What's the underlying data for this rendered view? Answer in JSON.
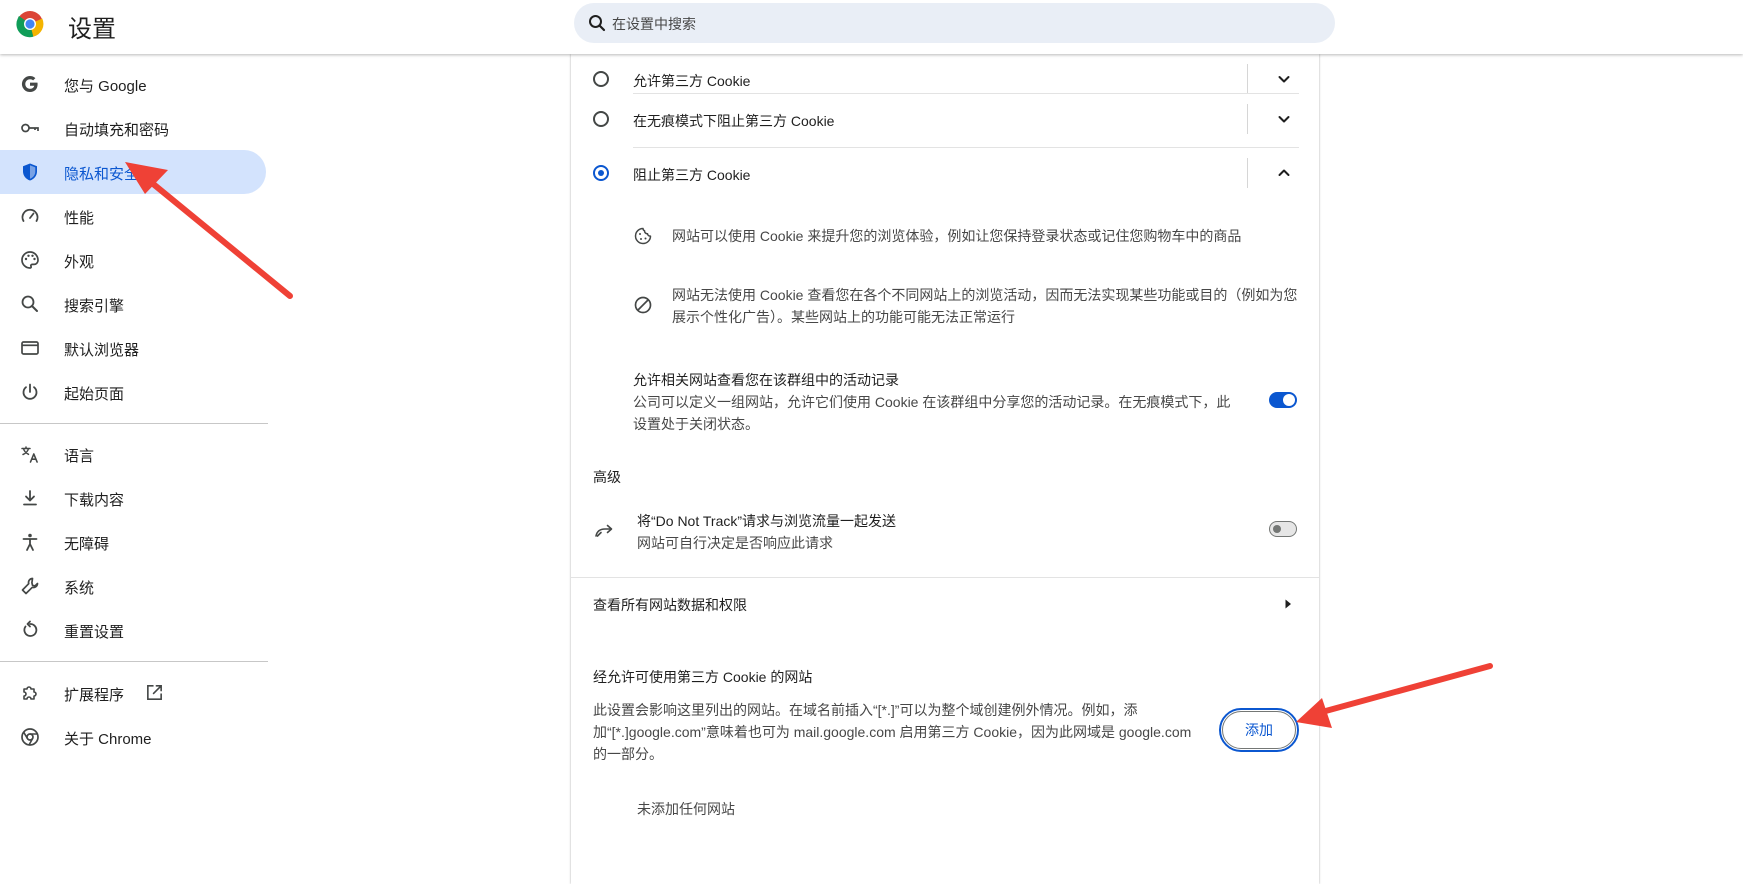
{
  "header": {
    "title": "设置",
    "search_placeholder": "在设置中搜索"
  },
  "sidebar": {
    "items": [
      {
        "label": "您与 Google"
      },
      {
        "label": "自动填充和密码"
      },
      {
        "label": "隐私和安全"
      },
      {
        "label": "性能"
      },
      {
        "label": "外观"
      },
      {
        "label": "搜索引擎"
      },
      {
        "label": "默认浏览器"
      },
      {
        "label": "起始页面"
      },
      {
        "label": "语言"
      },
      {
        "label": "下载内容"
      },
      {
        "label": "无障碍"
      },
      {
        "label": "系统"
      },
      {
        "label": "重置设置"
      },
      {
        "label": "扩展程序"
      },
      {
        "label": "关于 Chrome"
      }
    ],
    "active_index": 2
  },
  "cookies": {
    "options": [
      {
        "label": "允许第三方 Cookie",
        "selected": false,
        "expanded": false
      },
      {
        "label": "在无痕模式下阻止第三方 Cookie",
        "selected": false,
        "expanded": false
      },
      {
        "label": "阻止第三方 Cookie",
        "selected": true,
        "expanded": true
      }
    ],
    "details": [
      {
        "icon": "cookie-icon",
        "text": "网站可以使用 Cookie 来提升您的浏览体验，例如让您保持登录状态或记住您购物车中的商品"
      },
      {
        "icon": "block-icon",
        "text": "网站无法使用 Cookie 查看您在各个不同网站上的浏览活动，因而无法实现某些功能或目的（例如为您展示个性化广告）。某些网站上的功能可能无法正常运行"
      }
    ],
    "related_sites": {
      "title": "允许相关网站查看您在该群组中的活动记录",
      "subtitle": "公司可以定义一组网站，允许它们使用 Cookie 在该群组中分享您的活动记录。在无痕模式下，此设置处于关闭状态。",
      "enabled": true
    }
  },
  "advanced": {
    "label": "高级",
    "dnt": {
      "title": "将“Do Not Track”请求与浏览流量一起发送",
      "subtitle": "网站可自行决定是否响应此请求",
      "enabled": false
    }
  },
  "site_data_link": "查看所有网站数据和权限",
  "allowed_sites": {
    "heading": "经允许可使用第三方 Cookie 的网站",
    "description": "此设置会影响这里列出的网站。在域名前插入“[*.]”可以为整个域创建例外情况。例如，添加“[*.]google.com”意味着也可为 mail.google.com 启用第三方 Cookie，因为此网域是 google.com 的一部分。",
    "add_label": "添加",
    "empty_text": "未添加任何网站"
  },
  "colors": {
    "accent": "#0b57d0",
    "active_bg": "#d3e3fd",
    "annotation": "#ef4136"
  }
}
